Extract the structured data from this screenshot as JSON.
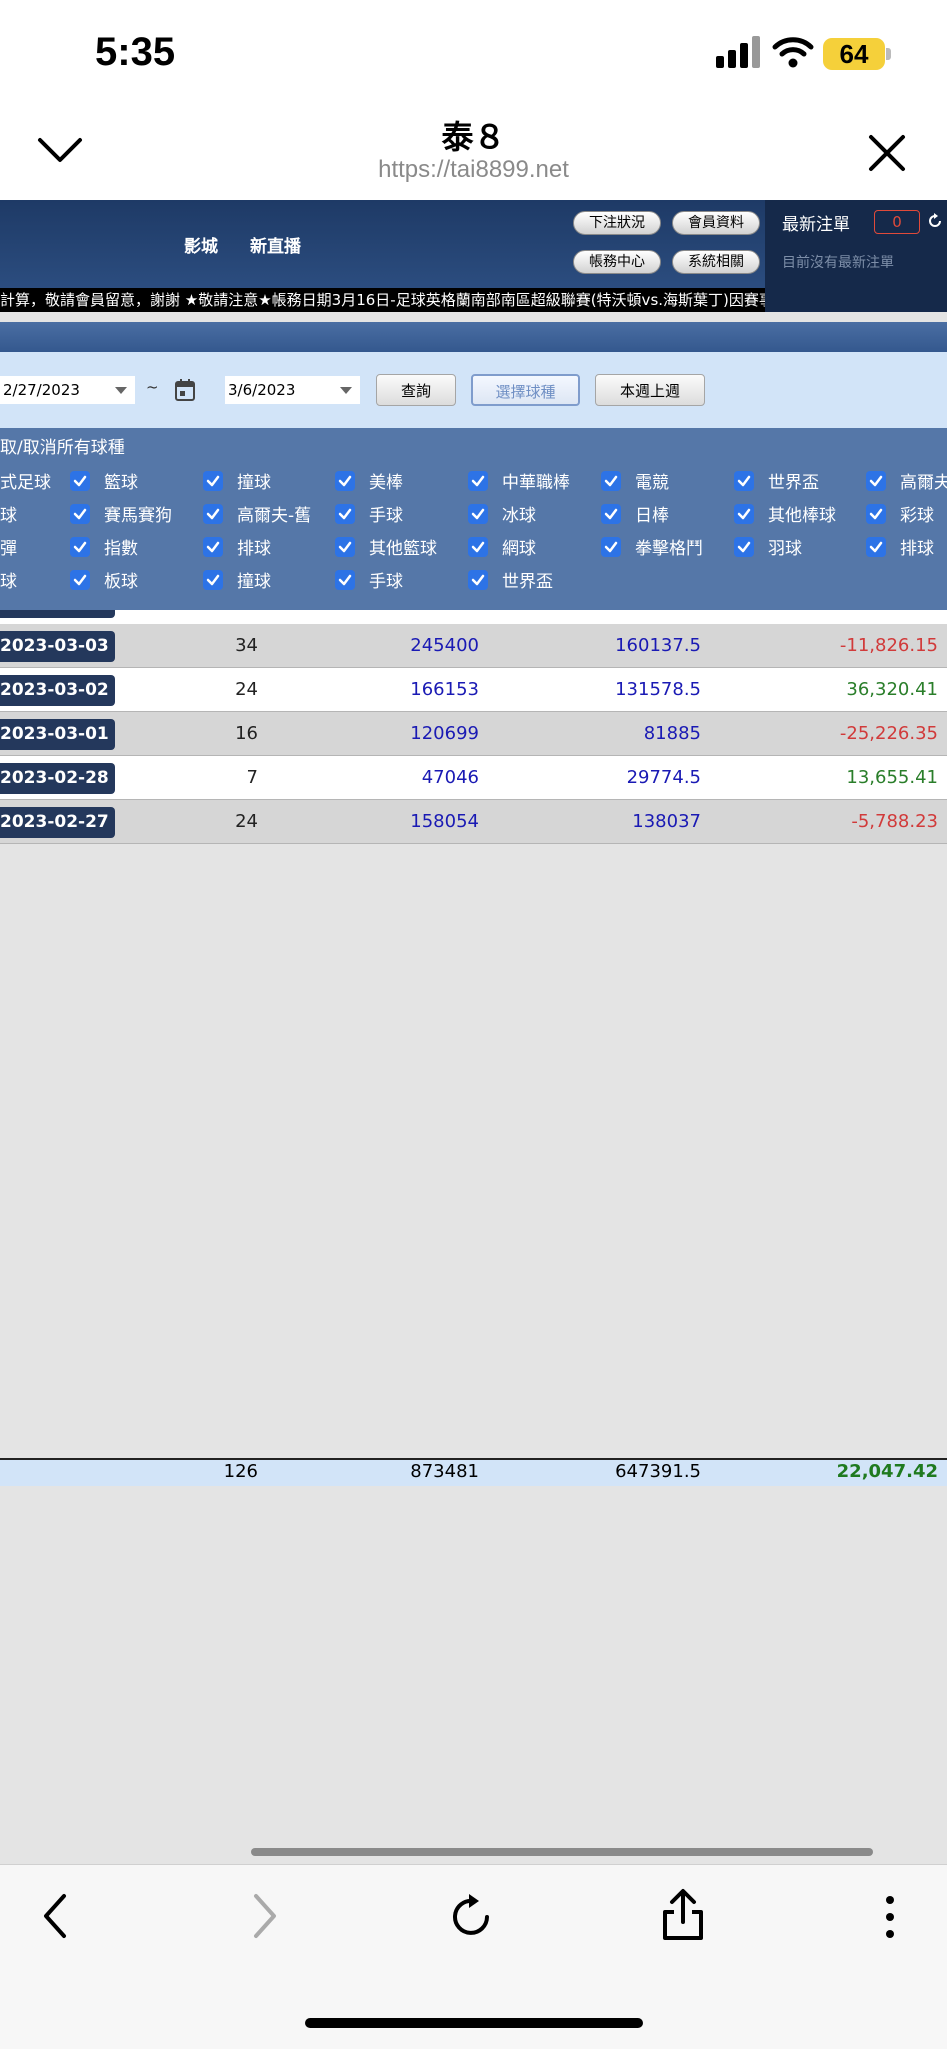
{
  "status_bar": {
    "time": "5:35",
    "battery": "64"
  },
  "browser": {
    "title": "泰８",
    "url": "https://tai8899.net"
  },
  "site_nav": {
    "links": [
      "影城",
      "新直播"
    ],
    "buttons": [
      "下注狀況",
      "會員資料",
      "帳務中心",
      "系統相關"
    ]
  },
  "latest_bets": {
    "title": "最新注單",
    "count": "0",
    "empty_text": "目前沒有最新注單"
  },
  "ticker": "計算，敬請會員留意，謝謝  ★敬請注意★帳務日期3月16日-足球英格蘭南部南區超級聯賽(特沃頓vs.海斯葉丁)因賽事改",
  "filter": {
    "date_from": "2/27/2023",
    "separator": "~",
    "date_to": "3/6/2023",
    "query_label": "查詢",
    "select_sport_label": "選擇球種",
    "week_label": "本週上週"
  },
  "sports": {
    "toggle_all": "取/取消所有球種",
    "rows": [
      [
        "式足球",
        "籃球",
        "撞球",
        "美棒",
        "中華職棒",
        "電競",
        "世界盃",
        "高爾夫"
      ],
      [
        "球",
        "賽馬賽狗",
        "高爾夫-舊",
        "手球",
        "冰球",
        "日棒",
        "其他棒球",
        "彩球"
      ],
      [
        "彈",
        "指數",
        "排球",
        "其他籃球",
        "網球",
        "拳擊格鬥",
        "羽球",
        "排球"
      ],
      [
        "球",
        "板球",
        "撞球",
        "手球",
        "世界盃"
      ]
    ]
  },
  "table": {
    "rows": [
      {
        "date": "2023-03-03",
        "count": "34",
        "amount": "245400",
        "valid": "160137.5",
        "result": "-11,826.15",
        "tone": "neg"
      },
      {
        "date": "2023-03-02",
        "count": "24",
        "amount": "166153",
        "valid": "131578.5",
        "result": "36,320.41",
        "tone": "pos"
      },
      {
        "date": "2023-03-01",
        "count": "16",
        "amount": "120699",
        "valid": "81885",
        "result": "-25,226.35",
        "tone": "neg"
      },
      {
        "date": "2023-02-28",
        "count": "7",
        "amount": "47046",
        "valid": "29774.5",
        "result": "13,655.41",
        "tone": "pos"
      },
      {
        "date": "2023-02-27",
        "count": "24",
        "amount": "158054",
        "valid": "138037",
        "result": "-5,788.23",
        "tone": "neg"
      }
    ],
    "totals": {
      "count": "126",
      "amount": "873481",
      "valid": "647391.5",
      "result": "22,047.42"
    }
  },
  "colors": {
    "header": "#2f5286",
    "panel": "#5577a8",
    "negative": "#d13a3a",
    "positive": "#2a7e2a",
    "checkbox": "#2d73e6"
  },
  "icons": [
    "signal-icon",
    "wifi-icon",
    "chevron-down-icon",
    "close-icon",
    "refresh-icon",
    "calendar-icon",
    "checkbox-icon",
    "back-icon",
    "forward-icon",
    "reload-icon",
    "share-icon",
    "more-icon"
  ]
}
